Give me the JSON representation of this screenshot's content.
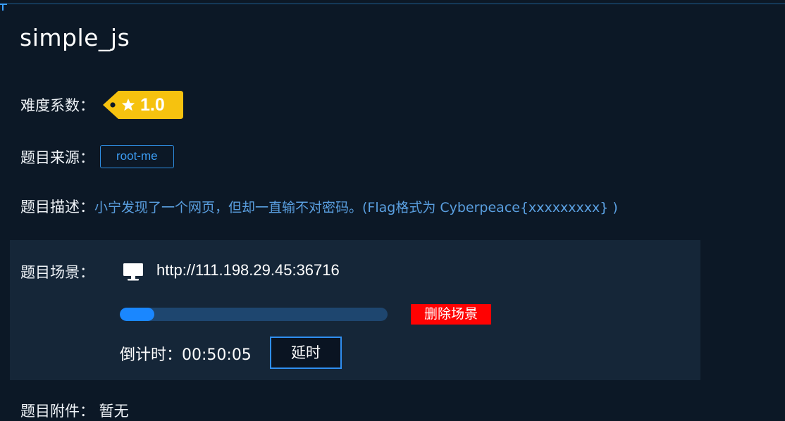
{
  "challenge": {
    "title": "simple_js",
    "difficulty_label": "难度系数：",
    "difficulty_value": "1.0",
    "source_label": "题目来源：",
    "source_value": "root-me",
    "description_label": "题目描述：",
    "description_value": "小宁发现了一个网页，但却一直输不对密码。(Flag格式为 Cyberpeace{xxxxxxxxx} )",
    "scene_label": "题目场景：",
    "scene_url": "http://111.198.29.45:36716",
    "progress_fraction": 0.13,
    "delete_label": "删除场景",
    "countdown_text": "倒计时：00:50:05",
    "extend_label": "延时",
    "attachment_text": "题目附件： 暂无"
  },
  "icons": {
    "difficulty": "star-price-tag-icon",
    "scene": "monitor-icon"
  },
  "colors": {
    "background": "#0c1826",
    "panel": "#152638",
    "accent": "#2f8ef0",
    "difficulty_tag": "#f6c20f",
    "danger": "#ff0202"
  }
}
